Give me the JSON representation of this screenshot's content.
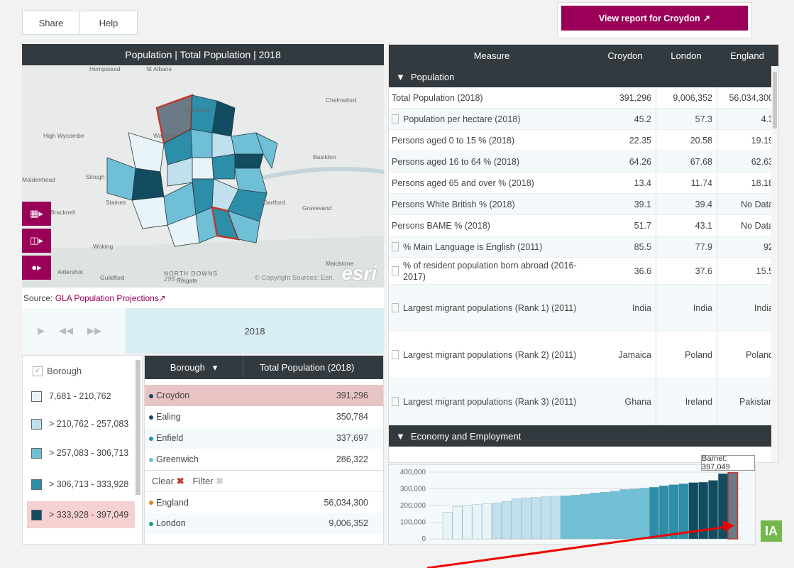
{
  "top_tabs": {
    "share": "Share",
    "help": "Help"
  },
  "report_button": {
    "label": "View report for Croydon"
  },
  "map": {
    "title": "Population | Total Population | 2018",
    "places": [
      "Hempstead",
      "St Albans",
      "Chelmsford",
      "Cheshunt",
      "High Wycombe",
      "Watford",
      "Basildon",
      "Maidenhead",
      "Slough",
      "Bracknell",
      "Staines",
      "Dartford",
      "Gravesend",
      "Woking",
      "Aldershot",
      "Guildford",
      "Reigate",
      "Maidstone",
      "NORTH DOWNS"
    ],
    "scale": "295 m",
    "copyright": "© Copyright Sources: Esri,",
    "esri": "esri",
    "source_label": "Source:",
    "source_link": "GLA Population Projections"
  },
  "time": {
    "year": "2018"
  },
  "legend": {
    "header": "Borough",
    "items": [
      {
        "label": "7,681 - 210,762",
        "color": "#e9f4f8"
      },
      {
        "label": "> 210,762 - 257,083",
        "color": "#bfe0ec"
      },
      {
        "label": "> 257,083 - 306,713",
        "color": "#6fbfd6"
      },
      {
        "label": "> 306,713 - 333,928",
        "color": "#2c8ea8"
      },
      {
        "label": "> 333,928 - 397,049",
        "color": "#114c60"
      }
    ]
  },
  "borough_table": {
    "col1": "Borough",
    "col2": "Total Population (2018)",
    "rows": [
      {
        "name": "Croydon",
        "value": "391,296"
      },
      {
        "name": "Ealing",
        "value": "350,784"
      },
      {
        "name": "Enfield",
        "value": "337,697"
      },
      {
        "name": "Greenwich",
        "value": "286,322"
      }
    ],
    "clear": "Clear",
    "filter": "Filter",
    "comparators": [
      {
        "name": "England",
        "value": "56,034,300",
        "color": "#e67e22"
      },
      {
        "name": "London",
        "value": "9,006,352",
        "color": "#16a085"
      }
    ]
  },
  "measure_table": {
    "headers": [
      "Measure",
      "Croydon",
      "London",
      "England"
    ],
    "section1": "Population",
    "rows": [
      {
        "label": "Total Population (2018)",
        "icon": false,
        "v": [
          "391,296",
          "9,006,352",
          "56,034,300"
        ]
      },
      {
        "label": "Population per hectare (2018)",
        "icon": true,
        "v": [
          "45.2",
          "57.3",
          "4.3"
        ]
      },
      {
        "label": "Persons aged 0 to 15 % (2018)",
        "icon": false,
        "v": [
          "22.35",
          "20.58",
          "19.19"
        ]
      },
      {
        "label": "Persons aged 16 to 64 % (2018)",
        "icon": false,
        "v": [
          "64.26",
          "67.68",
          "62.63"
        ]
      },
      {
        "label": "Persons aged 65 and over % (2018)",
        "icon": false,
        "v": [
          "13.4",
          "11.74",
          "18.18"
        ]
      },
      {
        "label": "Persons White British % (2018)",
        "icon": false,
        "v": [
          "39.1",
          "39.4",
          "No Data"
        ]
      },
      {
        "label": "Persons BAME % (2018)",
        "icon": false,
        "v": [
          "51.7",
          "43.1",
          "No Data"
        ]
      },
      {
        "label": "% Main Language is English (2011)",
        "icon": true,
        "v": [
          "85.5",
          "77.9",
          "92"
        ]
      },
      {
        "label": "% of resident population born abroad (2016-2017)",
        "icon": true,
        "v": [
          "36.6",
          "37.6",
          "15.5"
        ]
      },
      {
        "label": "Largest migrant populations (Rank 1) (2011)",
        "icon": true,
        "v": [
          "India",
          "India",
          "India"
        ]
      },
      {
        "label": "Largest migrant populations (Rank 2) (2011)",
        "icon": true,
        "v": [
          "Jamaica",
          "Poland",
          "Poland"
        ]
      },
      {
        "label": "Largest migrant populations (Rank 3) (2011)",
        "icon": true,
        "v": [
          "Ghana",
          "Ireland",
          "Pakistan"
        ]
      }
    ],
    "section2": "Economy and Employment"
  },
  "chart_data": {
    "type": "bar",
    "yticks": [
      "400,000",
      "300,000",
      "200,000",
      "100,000",
      "0"
    ],
    "ylim": [
      0,
      400000
    ],
    "values": [
      160000,
      195000,
      200000,
      205000,
      210000,
      215000,
      225000,
      240000,
      245000,
      248000,
      252000,
      256000,
      258000,
      262000,
      268000,
      275000,
      280000,
      286322,
      296000,
      300000,
      305000,
      310000,
      318000,
      325000,
      330000,
      337697,
      340000,
      350784,
      391296,
      397049
    ],
    "tooltip": "Barnet: 397,049"
  },
  "logo": "IA"
}
